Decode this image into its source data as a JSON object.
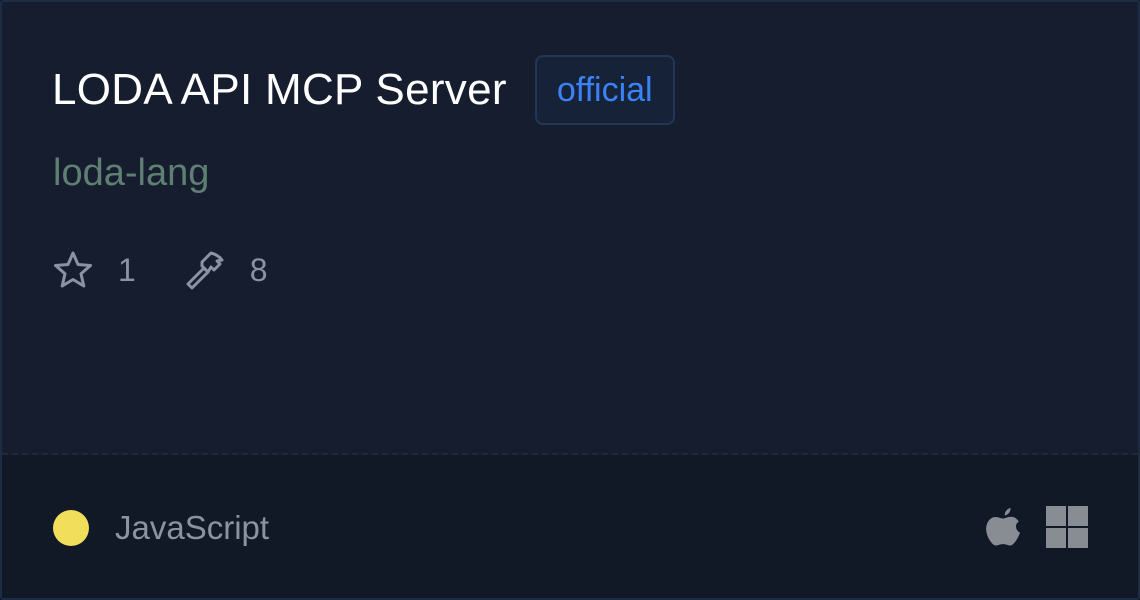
{
  "server": {
    "title": "LODA API MCP Server",
    "badge": "official",
    "owner": "loda-lang"
  },
  "stats": {
    "stars": "1",
    "tools": "8",
    "star_icon": "star-icon",
    "tools_icon": "hammer-icon"
  },
  "footer": {
    "language": "JavaScript",
    "language_color": "#f1de5b",
    "platforms": [
      "apple-icon",
      "windows-icon"
    ]
  },
  "colors": {
    "card_bg": "#151d2e",
    "footer_bg": "#111826",
    "badge_text": "#3b82f6",
    "owner_text": "#5f7f73",
    "muted_text": "#8a93a1"
  }
}
